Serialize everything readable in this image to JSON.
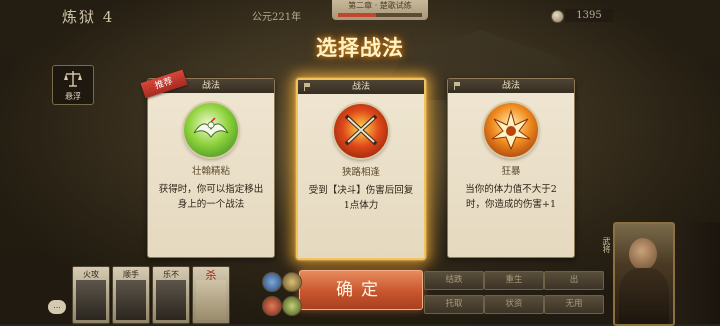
{
  "topbar": {
    "title": "炼狱 4",
    "era": "公元221年",
    "chapter": "第二章 · 楚歌试练",
    "chapter_progress": 0.45,
    "coins": "1395",
    "coin_icon": "coin-icon"
  },
  "badge": {
    "label": "悬浮",
    "icon": "scale-icon"
  },
  "heading": "选择战法",
  "cards": [
    {
      "header": "战法",
      "recommend": "推荐",
      "name": "壮翰精粘",
      "desc": "获得时，你可以指定移出身上的一个战法",
      "emblem_icon": "crane-icon",
      "emblem_color": "#6fbf2e"
    },
    {
      "header": "战法",
      "name": "狭路相逢",
      "desc": "受到【决斗】伤害后回复1点体力",
      "emblem_icon": "crossed-swords-icon",
      "emblem_color": "#d8421c"
    },
    {
      "header": "战法",
      "name": "狂暴",
      "desc": "当你的体力值不大于2时，你造成的伤害+1",
      "emblem_icon": "burst-icon",
      "emblem_color": "#e97a1a"
    }
  ],
  "confirm_label": "确定",
  "hand": [
    {
      "label": "火攻"
    },
    {
      "label": "顺手"
    },
    {
      "label": "乐不"
    },
    {
      "label": "杀"
    }
  ],
  "chat_label": "...",
  "side_buttons": [
    "结跌",
    "重生",
    "出",
    "托取",
    "状资",
    "无用"
  ],
  "portrait_label": "武将"
}
